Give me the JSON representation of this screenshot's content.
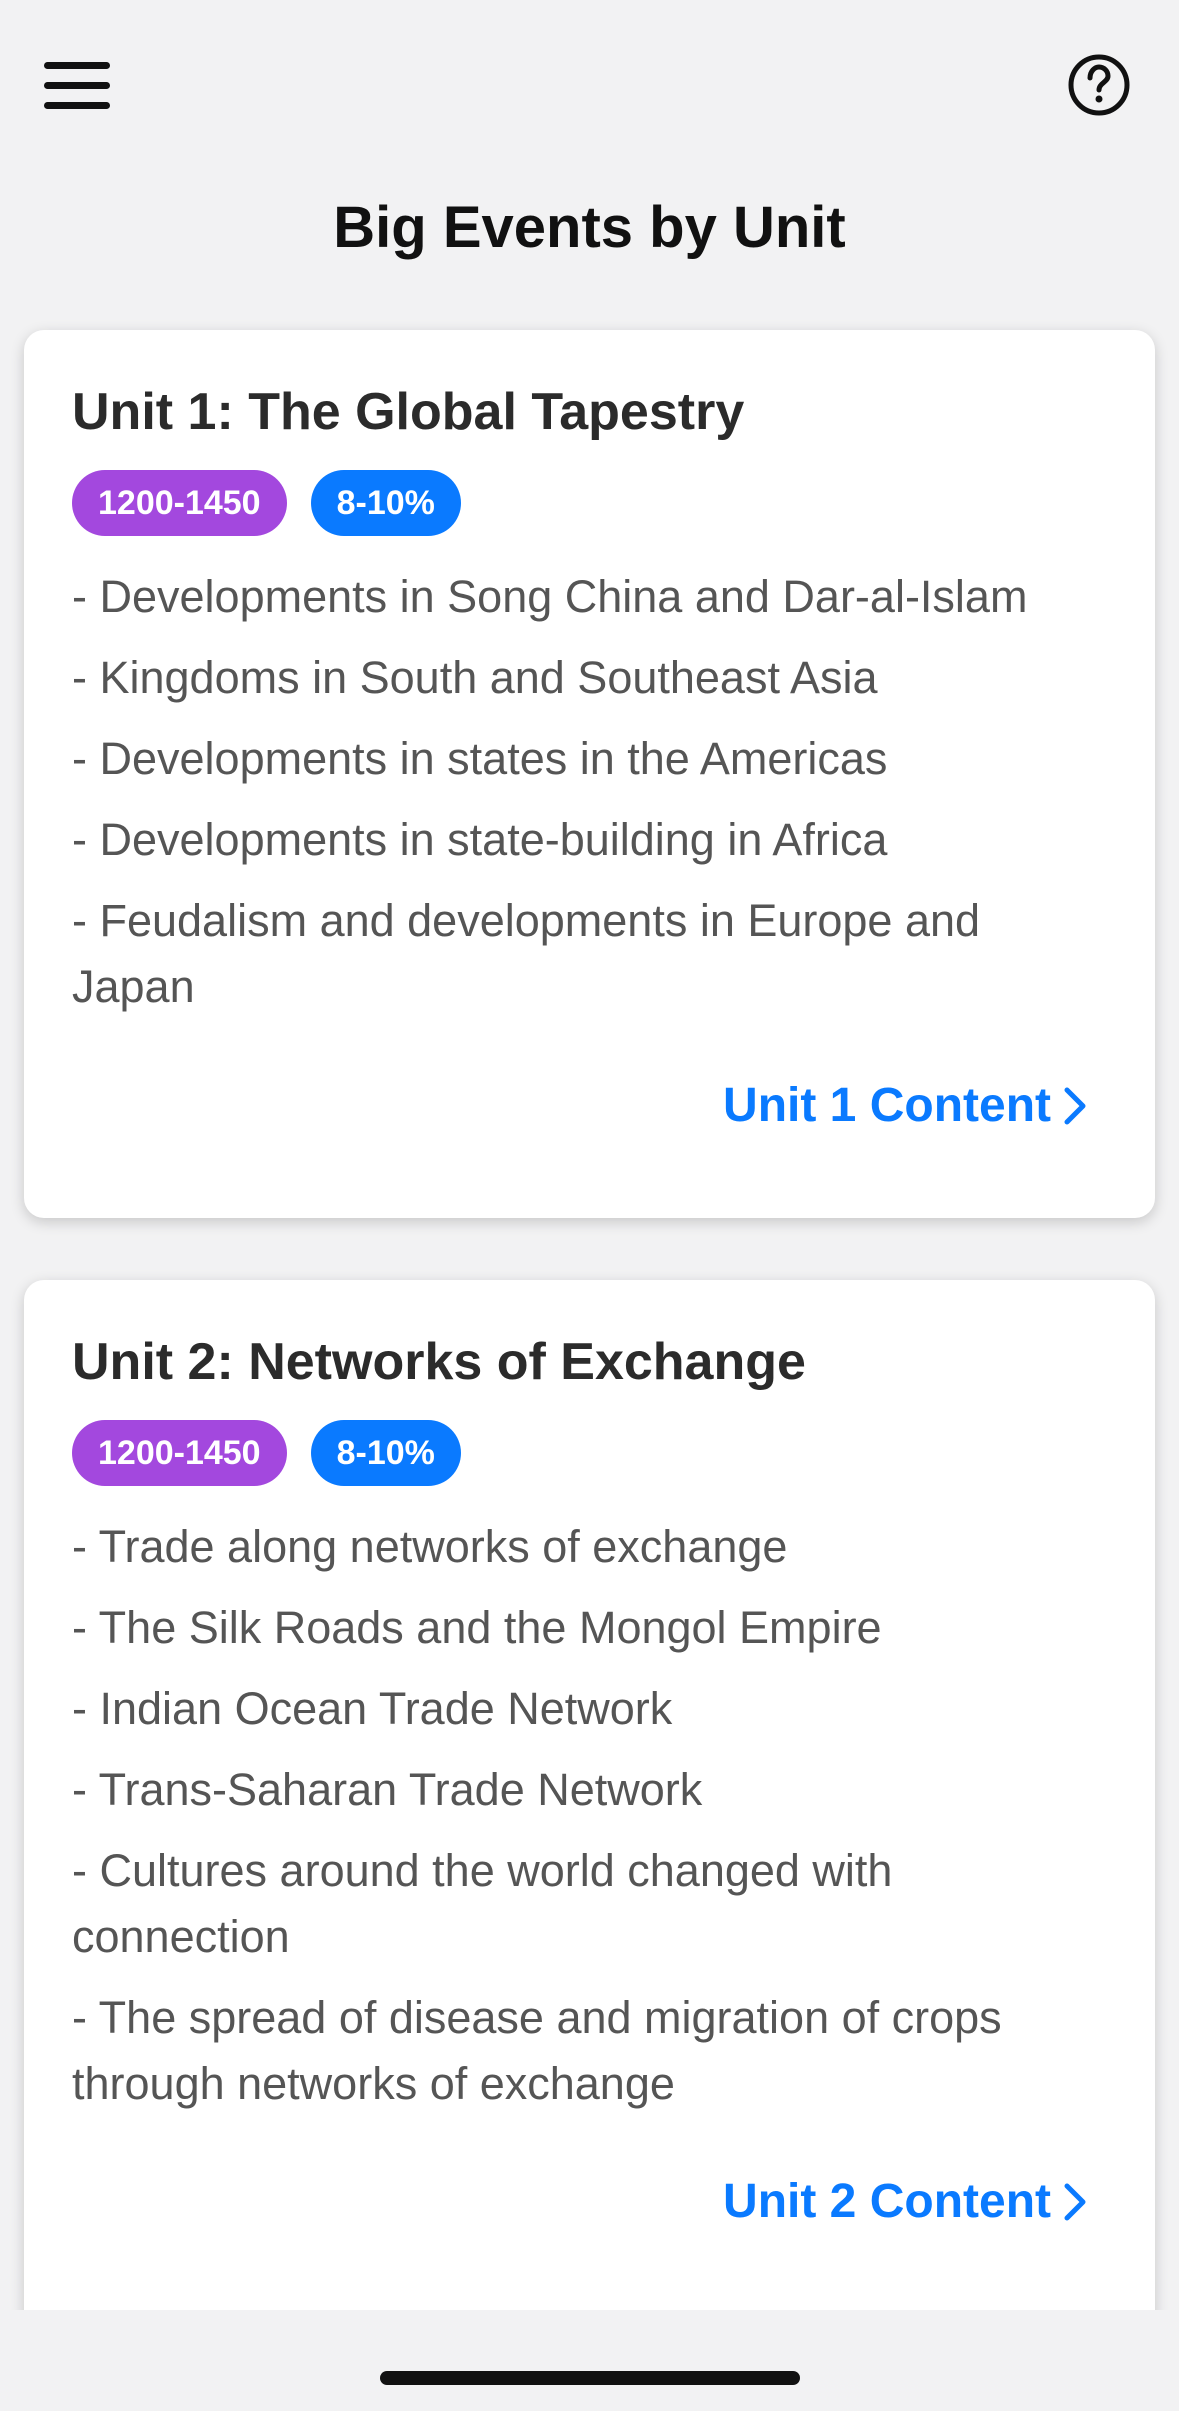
{
  "header": {
    "menu_icon": "hamburger-menu-icon",
    "help_icon": "question-circle-icon",
    "title": "Big Events by Unit"
  },
  "colors": {
    "era_badge": "#a348de",
    "weight_badge": "#0a7aff",
    "link": "#0a7aff"
  },
  "units": [
    {
      "title": "Unit 1: The Global Tapestry",
      "era": "1200-1450",
      "weight": "8-10%",
      "events": [
        "- Developments in Song China and Dar-al-Islam",
        "- Kingdoms in South and Southeast Asia",
        "- Developments in states in the Americas",
        "- Developments in state-building in Africa",
        "- Feudalism and developments in Europe and Japan"
      ],
      "link_label": "Unit 1 Content"
    },
    {
      "title": "Unit 2: Networks of Exchange",
      "era": "1200-1450",
      "weight": "8-10%",
      "events": [
        "- Trade along networks of exchange",
        "- The Silk Roads and the Mongol Empire",
        "- Indian Ocean Trade Network",
        "- Trans-Saharan Trade Network",
        "- Cultures around the world changed with connection",
        "- The spread of disease and migration of crops through networks of exchange"
      ],
      "link_label": "Unit 2 Content"
    }
  ]
}
